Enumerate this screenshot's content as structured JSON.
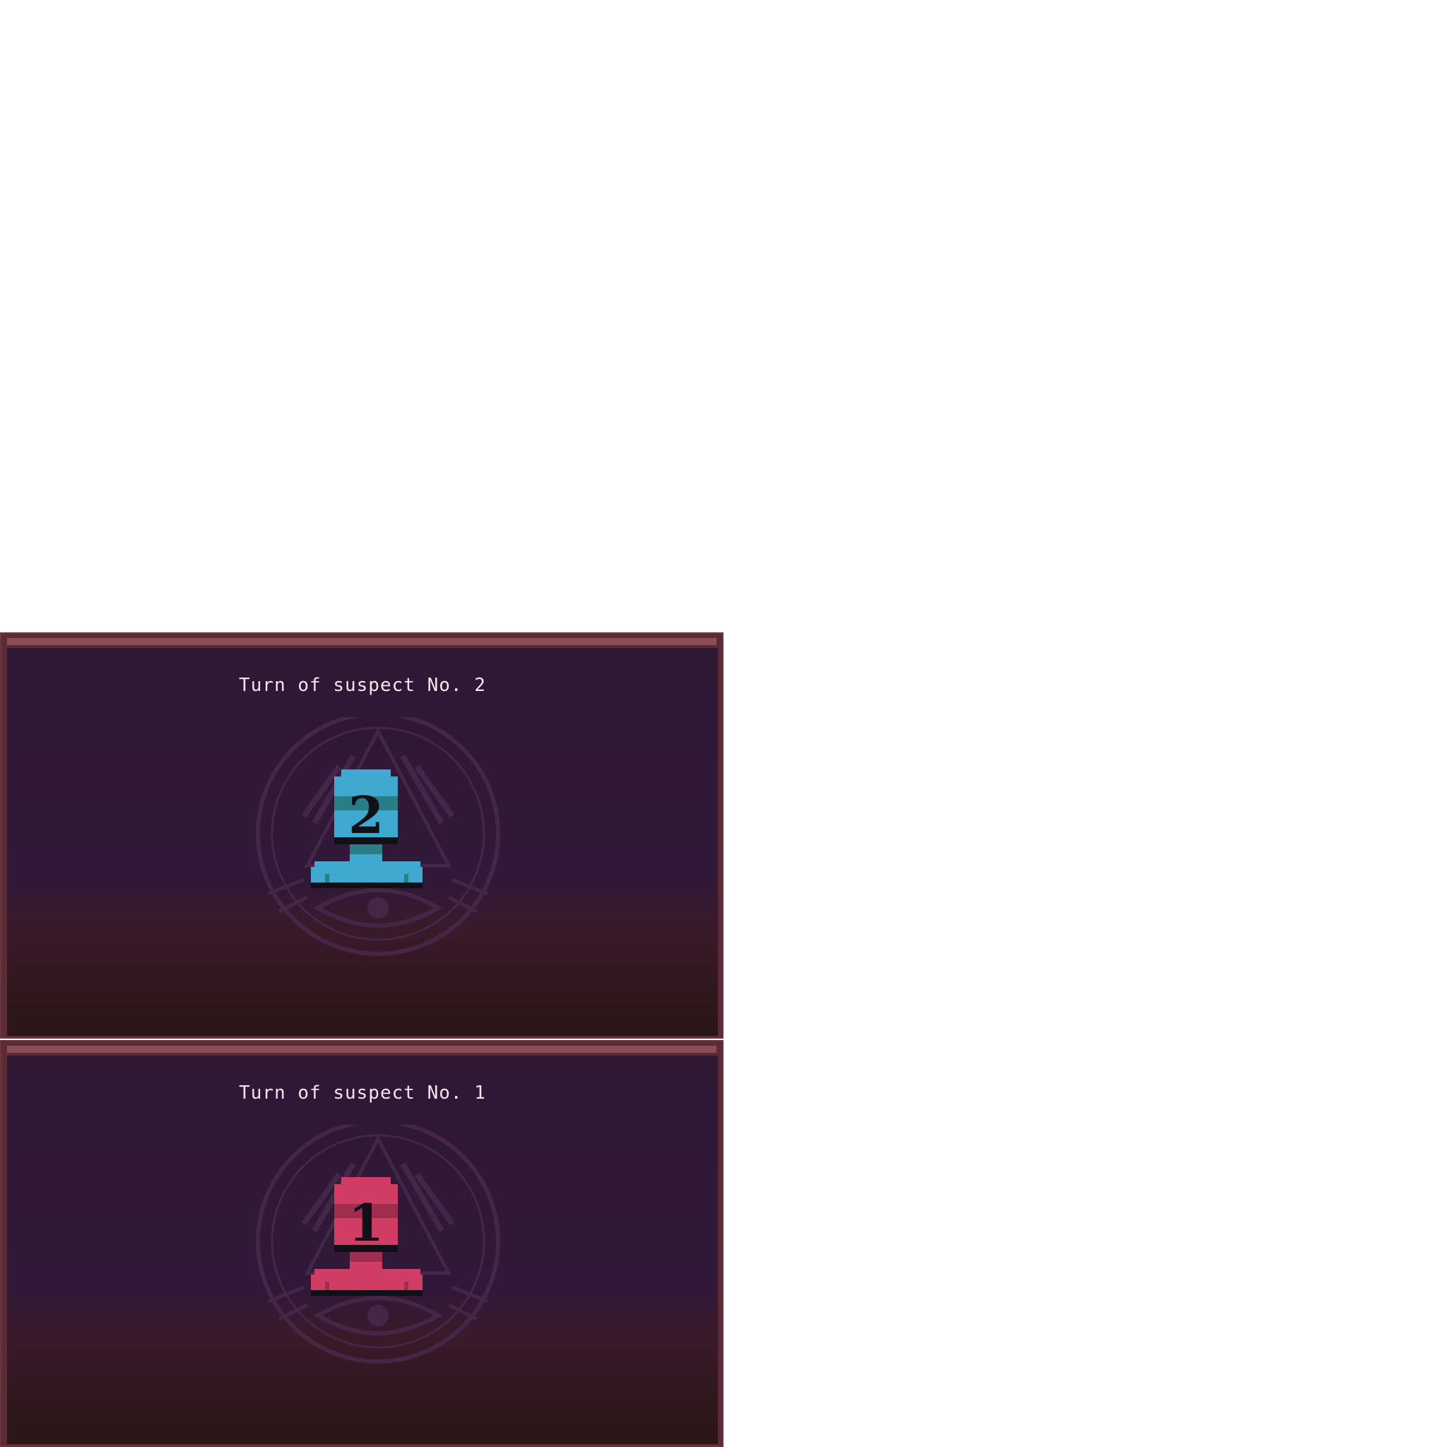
{
  "panels": [
    {
      "turn_text": "Turn of suspect No. 2",
      "suspect_number": "2",
      "suspect_icon": "suspect-bust-icon",
      "colors": {
        "body": "#3fa9d0",
        "band": "#2a7d86",
        "shadow": "#101018"
      }
    },
    {
      "turn_text": "Turn of suspect No. 1",
      "suspect_number": "1",
      "suspect_icon": "suspect-bust-icon",
      "colors": {
        "body": "#d03c64",
        "band": "#9e2d4f",
        "shadow": "#101018"
      }
    }
  ],
  "emblem_icon": "all-seeing-eye-emblem-icon",
  "palette": {
    "frame": "#5a2c36",
    "header_bar": "#8c4c56",
    "sky": "#2e1834",
    "ground": "#2b1617",
    "text": "#f1e6ec",
    "emblem": "#4a2a4c"
  }
}
